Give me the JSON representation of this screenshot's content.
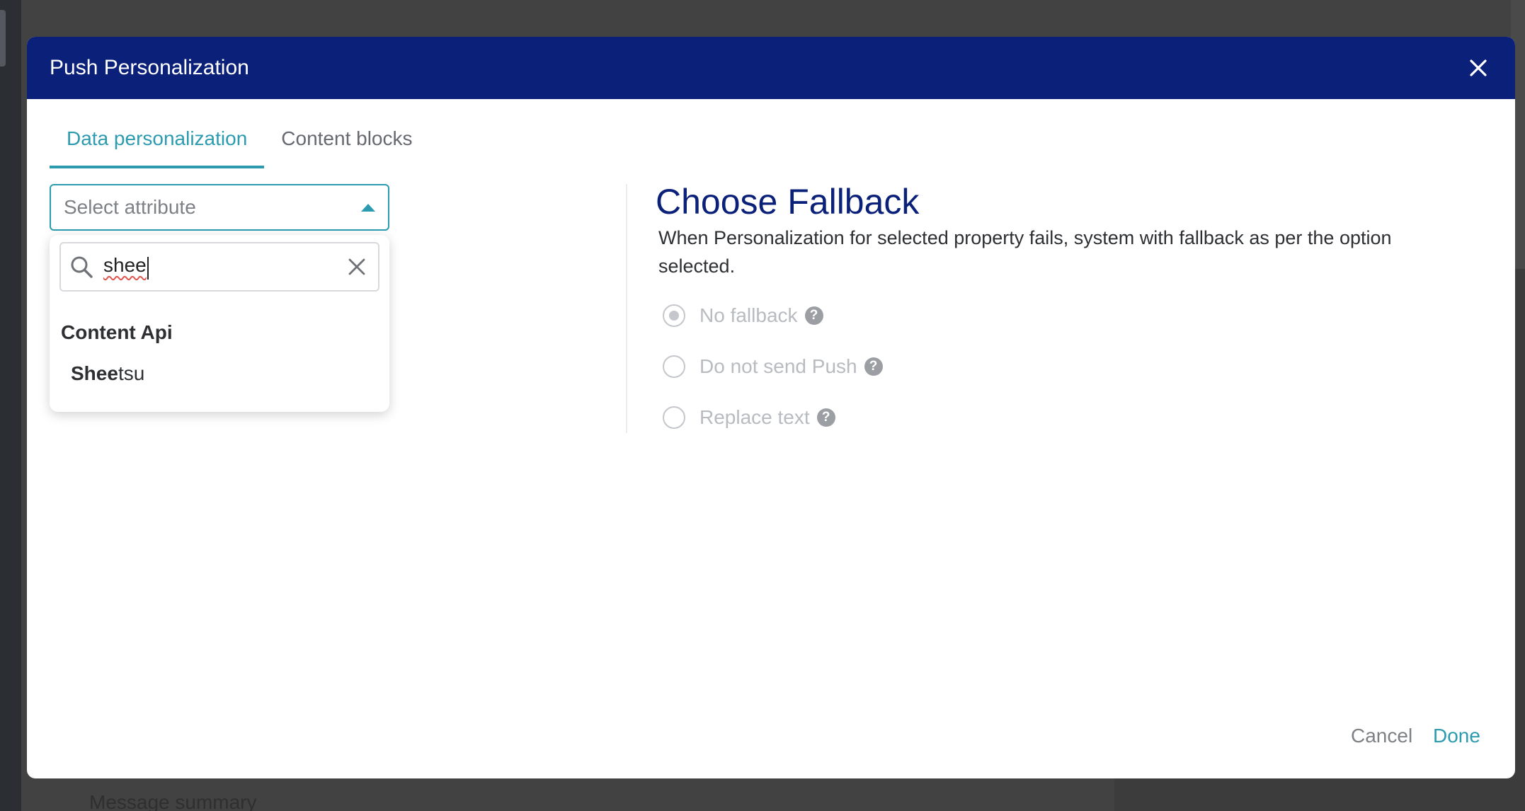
{
  "background": {
    "summary_text": "Message summary"
  },
  "modal": {
    "title": "Push Personalization",
    "close_icon": "close-icon",
    "tabs": [
      {
        "label": "Data personalization",
        "active": true
      },
      {
        "label": "Content blocks",
        "active": false
      }
    ],
    "attribute_select": {
      "placeholder": "Select attribute",
      "open": true,
      "search": {
        "value": "shee",
        "icon": "search-icon",
        "clear_icon": "clear-icon"
      },
      "groups": [
        {
          "label": "Content Api",
          "options": [
            {
              "match": "Shee",
              "rest": "tsu"
            }
          ]
        }
      ]
    },
    "fallback": {
      "title": "Choose Fallback",
      "description": "When Personalization for selected property fails, system with fallback as per the option selected.",
      "options": [
        {
          "label": "No fallback",
          "selected": true,
          "disabled": true
        },
        {
          "label": "Do not send Push",
          "selected": false,
          "disabled": true
        },
        {
          "label": "Replace text",
          "selected": false,
          "disabled": true
        }
      ]
    },
    "footer": {
      "cancel_label": "Cancel",
      "done_label": "Done"
    }
  },
  "colors": {
    "header_bg": "#0b2079",
    "accent": "#2c9bb0",
    "title": "#0b2079",
    "disabled": "#b8bbbf"
  }
}
